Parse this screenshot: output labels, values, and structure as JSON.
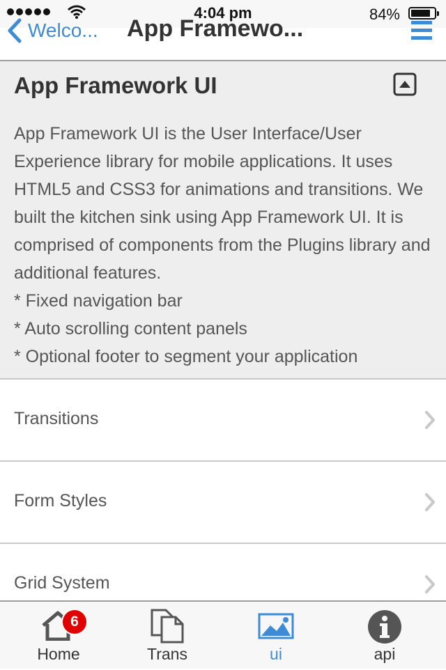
{
  "status_bar": {
    "time": "4:04 pm",
    "battery_percent": "84%",
    "battery_level": 0.84,
    "signal_dots": 5
  },
  "header": {
    "back_label": "Welco...",
    "title": "App Framewo...",
    "accent_color": "#3d8bd4"
  },
  "panel": {
    "title": "App Framework UI",
    "paragraph": "App Framework UI is the User Interface/User Experience library for mobile applications. It uses HTML5 and CSS3 for animations and transitions. We built the kitchen sink using App Framework UI. It is comprised of components from the Plugins library and additional features.",
    "bullets": [
      "* Fixed navigation bar",
      "* Auto scrolling content panels",
      "* Optional footer to segment your application"
    ]
  },
  "list": [
    {
      "label": "Transitions",
      "icon": "chevron-right-icon"
    },
    {
      "label": "Form Styles",
      "icon": "chevron-right-icon"
    },
    {
      "label": "Grid System",
      "icon": "chevron-right-icon"
    }
  ],
  "tabbar": {
    "tabs": [
      {
        "label": "Home",
        "icon": "home-icon",
        "badge": "6",
        "active": false
      },
      {
        "label": "Trans",
        "icon": "documents-icon",
        "active": false
      },
      {
        "label": "ui",
        "icon": "image-icon",
        "active": true
      },
      {
        "label": "api",
        "icon": "info-icon",
        "active": false
      }
    ],
    "badge_color": "#e00000"
  }
}
